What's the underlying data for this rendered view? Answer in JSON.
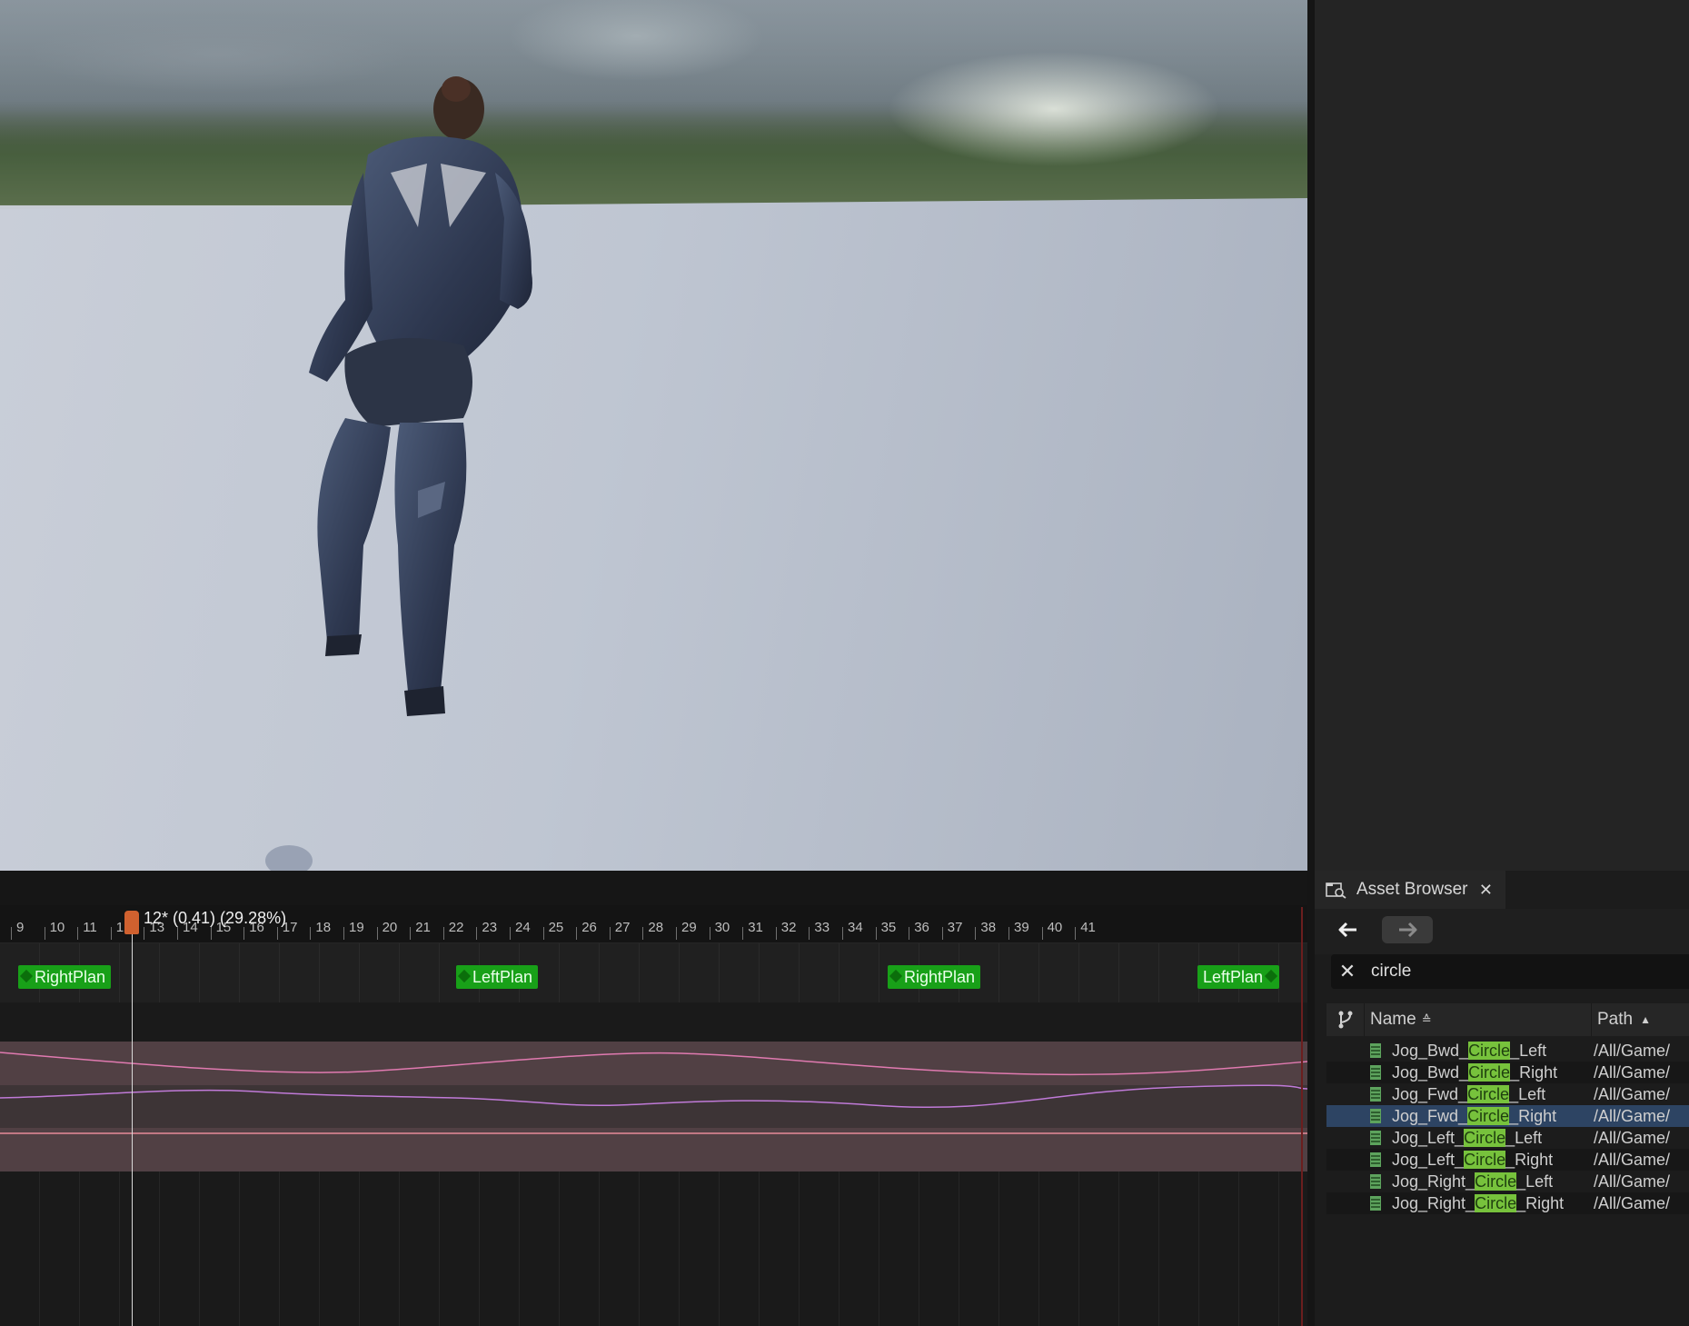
{
  "viewport": {},
  "timeline": {
    "playhead_label": "12* (0.41) (29.28%)",
    "ruler_ticks": [
      "9",
      "10",
      "11",
      "12",
      "13",
      "14",
      "15",
      "16",
      "17",
      "18",
      "19",
      "20",
      "21",
      "22",
      "23",
      "24",
      "25",
      "26",
      "27",
      "28",
      "29",
      "30",
      "31",
      "32",
      "33",
      "34",
      "35",
      "36",
      "37",
      "38",
      "39",
      "40",
      "41"
    ],
    "notifies": [
      {
        "label": "RightPlan"
      },
      {
        "label": "LeftPlan"
      },
      {
        "label": "RightPlan"
      },
      {
        "label": "LeftPlan"
      }
    ]
  },
  "asset_browser": {
    "tab_title": "Asset Browser",
    "close_glyph": "✕",
    "back_glyph": "🡐",
    "forward_glyph": "🡒",
    "search_value": "circle",
    "search_clear_glyph": "✕",
    "columns": {
      "name": "Name",
      "path": "Path",
      "name_sort": "≙",
      "path_sort": "▲"
    },
    "rows": [
      {
        "pre": "Jog_Bwd_",
        "hl": "Circle",
        "post": "_Left",
        "path": "/All/Game/",
        "selected": false
      },
      {
        "pre": "Jog_Bwd_",
        "hl": "Circle",
        "post": "_Right",
        "path": "/All/Game/",
        "selected": false
      },
      {
        "pre": "Jog_Fwd_",
        "hl": "Circle",
        "post": "_Left",
        "path": "/All/Game/",
        "selected": false
      },
      {
        "pre": "Jog_Fwd_",
        "hl": "Circle",
        "post": "_Right",
        "path": "/All/Game/",
        "selected": true
      },
      {
        "pre": "Jog_Left_",
        "hl": "Circle",
        "post": "_Left",
        "path": "/All/Game/",
        "selected": false
      },
      {
        "pre": "Jog_Left_",
        "hl": "Circle",
        "post": "_Right",
        "path": "/All/Game/",
        "selected": false
      },
      {
        "pre": "Jog_Right_",
        "hl": "Circle",
        "post": "_Left",
        "path": "/All/Game/",
        "selected": false
      },
      {
        "pre": "Jog_Right_",
        "hl": "Circle",
        "post": "_Right",
        "path": "/All/Game/",
        "selected": false
      }
    ]
  },
  "colors": {
    "notify_green": "#18a018",
    "highlight_green": "#77c23c",
    "selection_blue": "#2d4463",
    "playhead_orange": "#d0612f"
  }
}
